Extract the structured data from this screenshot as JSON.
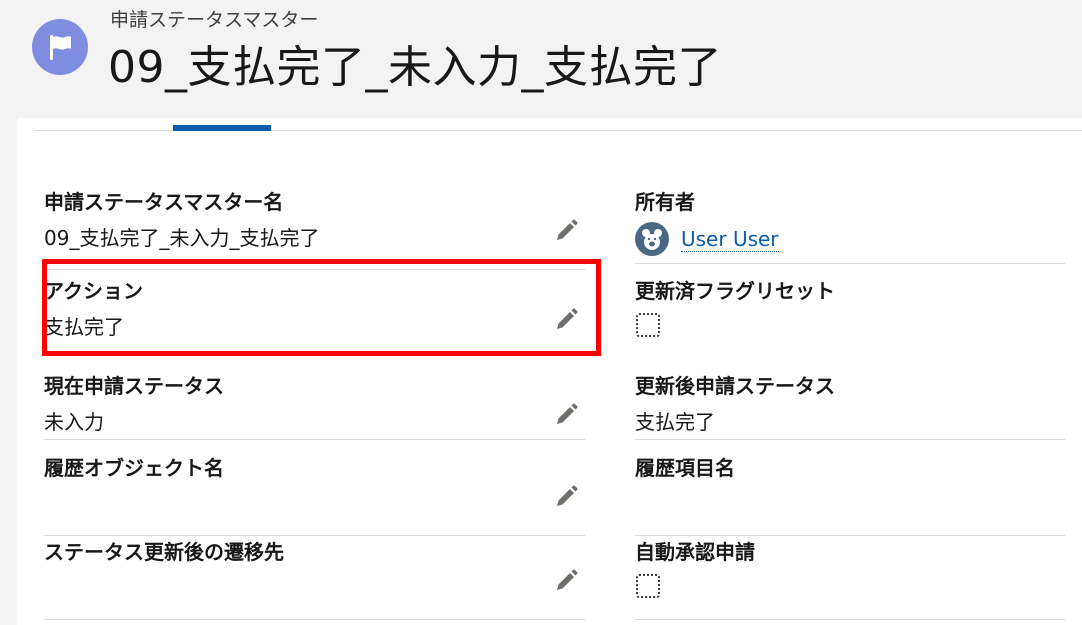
{
  "header": {
    "object_type": "申請ステータスマスター",
    "record_title": "09_支払完了_未入力_支払完了",
    "icon": "flag-icon"
  },
  "fields": {
    "status_master_name": {
      "label": "申請ステータスマスター名",
      "value": "09_支払完了_未入力_支払完了"
    },
    "owner": {
      "label": "所有者",
      "value": "User User"
    },
    "action": {
      "label": "アクション",
      "value": "支払完了"
    },
    "updated_flag_reset": {
      "label": "更新済フラグリセット",
      "checked": false
    },
    "current_status": {
      "label": "現在申請ステータス",
      "value": "未入力"
    },
    "updated_status": {
      "label": "更新後申請ステータス",
      "value": "支払完了"
    },
    "history_object_name": {
      "label": "履歴オブジェクト名",
      "value": ""
    },
    "history_item_name": {
      "label": "履歴項目名",
      "value": ""
    },
    "redirect_after_update": {
      "label": "ステータス更新後の遷移先",
      "value": ""
    },
    "auto_approval": {
      "label": "自動承認申請",
      "checked": false
    }
  },
  "colors": {
    "accent": "#0b5cab",
    "icon_bg": "#7f8de1",
    "highlight": "#ff0000"
  }
}
